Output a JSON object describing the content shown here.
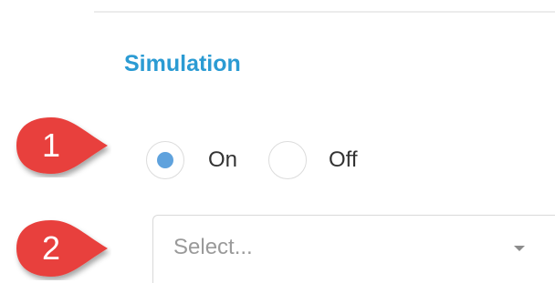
{
  "section": {
    "title": "Simulation"
  },
  "callouts": [
    {
      "number": "1",
      "color": "#e8413c"
    },
    {
      "number": "2",
      "color": "#e8413c"
    }
  ],
  "simulation_toggle": {
    "options": [
      {
        "label": "On",
        "selected": true
      },
      {
        "label": "Off",
        "selected": false
      }
    ]
  },
  "select": {
    "placeholder": "Select...",
    "icon": "chevron-down-icon"
  },
  "colors": {
    "accent": "#2b9bd3",
    "radio_selected": "#5fa2dd",
    "callout": "#e8413c"
  }
}
